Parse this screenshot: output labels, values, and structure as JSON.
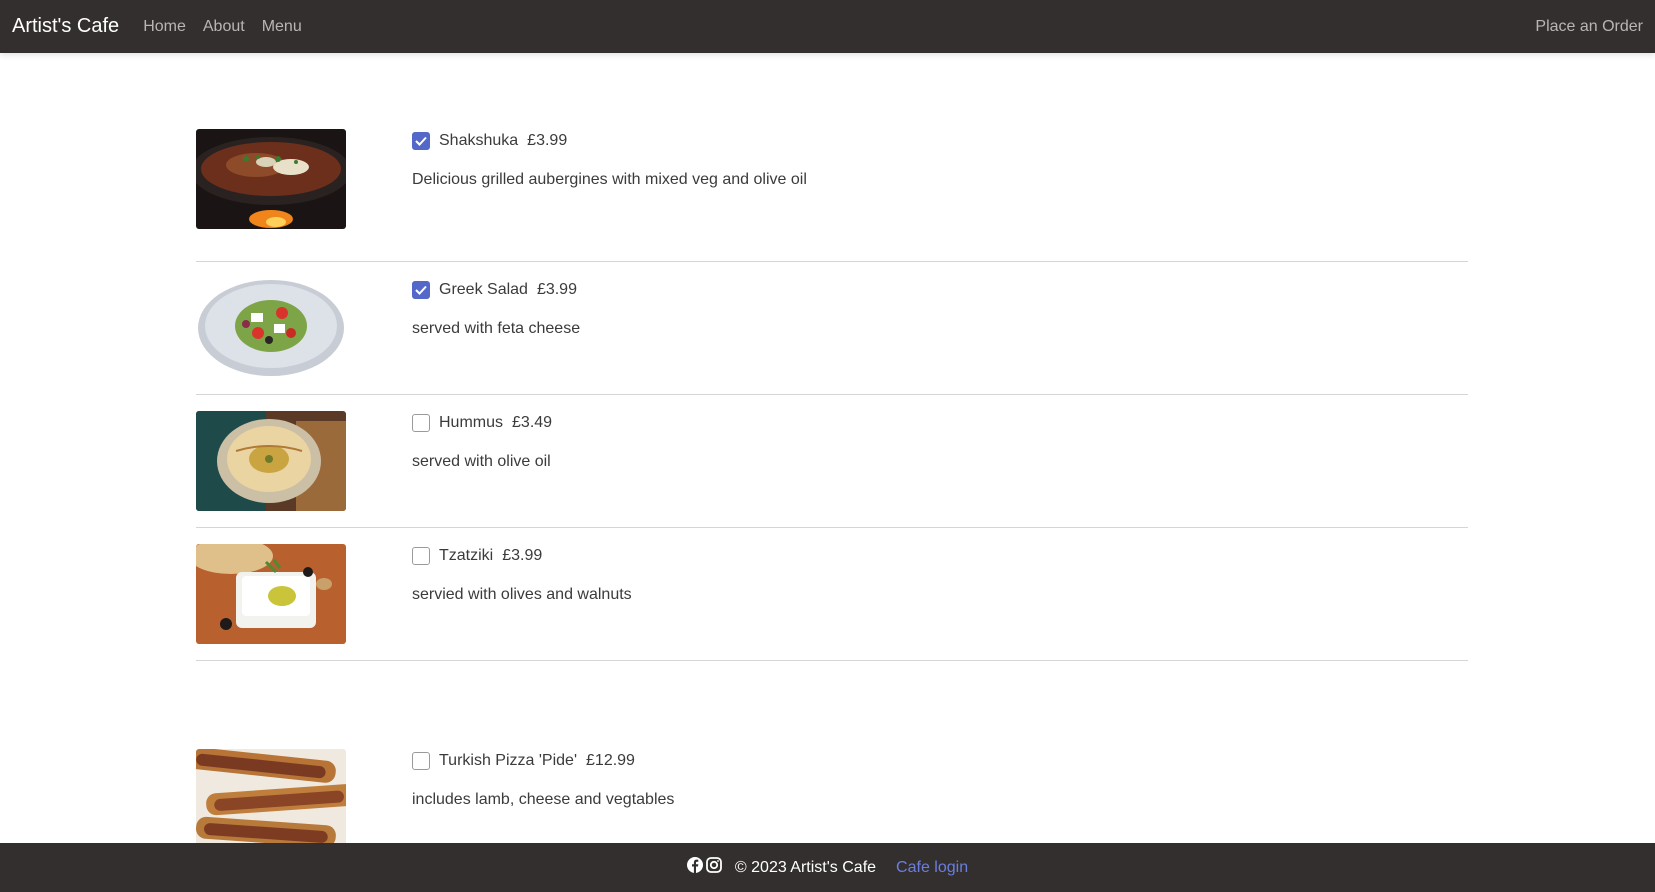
{
  "nav": {
    "brand": "Artist's Cafe",
    "links": [
      "Home",
      "About",
      "Menu"
    ],
    "order_link": "Place an Order"
  },
  "menu": {
    "items": [
      {
        "name": "Shakshuka",
        "price": "£3.99",
        "description": "Delicious grilled aubergines with mixed veg and olive oil",
        "checked": true,
        "image": "shakshuka-photo"
      },
      {
        "name": "Greek Salad",
        "price": "£3.99",
        "description": "served with feta cheese",
        "checked": true,
        "image": "greek-salad-photo"
      },
      {
        "name": "Hummus",
        "price": "£3.49",
        "description": "served with olive oil",
        "checked": false,
        "image": "hummus-photo"
      },
      {
        "name": "Tzatziki",
        "price": "£3.99",
        "description": "servied with olives and walnuts",
        "checked": false,
        "image": "tzatziki-photo"
      },
      {
        "name": "Turkish Pizza 'Pide'",
        "price": "£12.99",
        "description": "includes lamb, cheese and vegtables",
        "checked": false,
        "image": "pide-photo"
      }
    ]
  },
  "footer": {
    "icons": [
      "facebook-icon",
      "instagram-icon"
    ],
    "copyright": "© 2023 Artist's Cafe",
    "login_link": "Cafe login"
  },
  "colors": {
    "nav_bg": "#332f2f",
    "checkbox_accent": "#5368c8",
    "link_accent": "#6a7ee0"
  }
}
